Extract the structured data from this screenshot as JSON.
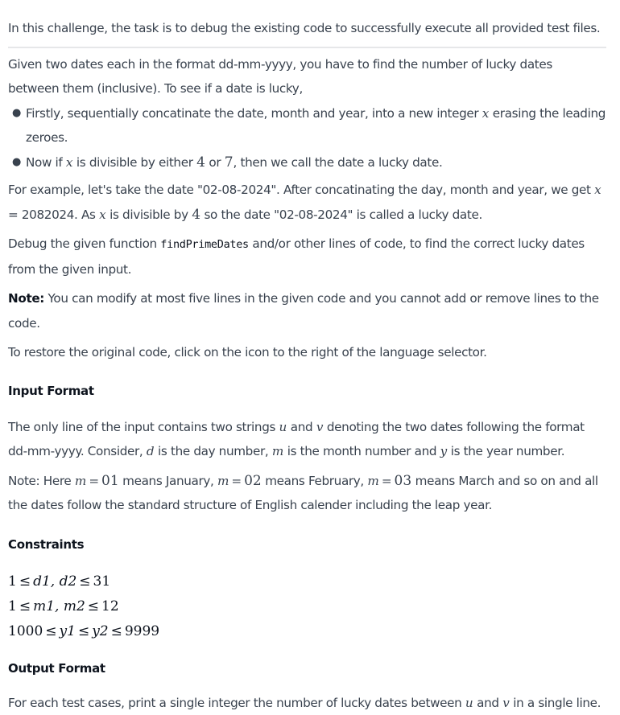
{
  "intro": "In this challenge, the task is to debug the existing code to successfully execute all provided test files.",
  "problem": {
    "p1": "Given two dates each in the format dd-mm-yyyy, you have to find the number of lucky dates between them (inclusive). To see if a date is lucky,",
    "bullets": [
      {
        "pre": "Firstly, sequentially concatinate the date, month and year, into a new integer ",
        "var": "x",
        "post": " erasing the leading zeroes."
      },
      {
        "pre": "Now if ",
        "var": "x",
        "mid1": " is divisible by either ",
        "n1": "4",
        "mid2": " or ",
        "n2": "7",
        "post": ", then we call the date a lucky date."
      }
    ],
    "example": {
      "pre": "For example, let's take the date \"02-08-2024\". After concatinating the day, month and year, we get ",
      "var": "x",
      "mid": " = 2082024. As ",
      "var2": "x",
      "mid2": " is divisible by ",
      "num": "4",
      "post": " so the date \"02-08-2024\" is called a lucky date."
    },
    "debug": {
      "pre": "Debug the given function ",
      "code": "findPrimeDates",
      "post": " and/or other lines of code, to find the correct lucky dates from the given input."
    },
    "note": {
      "label": "Note:",
      "text": " You can modify at most five lines in the given code and you cannot add or remove lines to the code."
    },
    "restore": "To restore the original code, click on the icon to the right of the language selector."
  },
  "input_format": {
    "heading": "Input Format",
    "p1": {
      "pre": "The only line of the input contains two strings ",
      "u": "u",
      "and": " and ",
      "v": "v",
      "mid": " denoting the two dates following the format dd-mm-yyyy. Consider, ",
      "d": "d",
      "t1": " is the day number, ",
      "m": "m",
      "t2": " is the month number and ",
      "y": "y",
      "post": " is the year number."
    },
    "p2": {
      "pre": "Note: Here ",
      "m": "m",
      "eq": "=",
      "v1": "01",
      "t1": " means January, ",
      "v2": "02",
      "t2": " means February, ",
      "v3": "03",
      "post": " means March and so on and all the dates follow the standard structure of English calender including the leap year."
    }
  },
  "constraints": {
    "heading": "Constraints",
    "lines": [
      {
        "a": "1",
        "r1": "≤",
        "b": "d1, d2",
        "r2": "≤",
        "c": "31"
      },
      {
        "a": "1",
        "r1": "≤",
        "b": "m1, m2",
        "r2": "≤",
        "c": "12"
      },
      {
        "a": "1000",
        "r1": "≤",
        "b": "y1",
        "r2": "≤",
        "c": "y2",
        "r3": "≤",
        "d": "9999"
      }
    ]
  },
  "output_format": {
    "heading": "Output Format",
    "pre": "For each test cases, print a single integer the number of lucky dates between ",
    "u": "u",
    "and": " and ",
    "v": "v",
    "post": " in a single line."
  }
}
